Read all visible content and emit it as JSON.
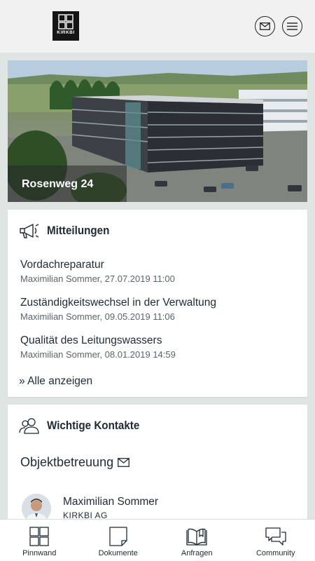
{
  "header": {
    "logo_text": "KIRKBI"
  },
  "hero": {
    "title": "Rosenweg 24"
  },
  "notices": {
    "title": "Mitteilungen",
    "items": [
      {
        "title": "Vordachreparatur",
        "meta": "Maximilian Sommer, 27.07.2019 11:00"
      },
      {
        "title": "Zuständigkeitswechsel in der Verwaltung",
        "meta": "Maximilian Sommer, 09.05.2019 11:06"
      },
      {
        "title": "Qualität des Leitungswassers",
        "meta": "Maximilian Sommer, 08.01.2019 14:59"
      }
    ],
    "show_all": "» Alle anzeigen"
  },
  "contacts": {
    "title": "Wichtige Kontakte",
    "section": "Objektbetreuung",
    "person": {
      "name": "Maximilian Sommer",
      "org": "KIRKBI AG"
    }
  },
  "nav": {
    "items": [
      {
        "label": "Pinnwand",
        "icon": "grid-icon"
      },
      {
        "label": "Dokumente",
        "icon": "document-icon"
      },
      {
        "label": "Anfragen",
        "icon": "book-icon"
      },
      {
        "label": "Community",
        "icon": "chat-icon"
      }
    ]
  },
  "colors": {
    "accent": "#2d5a3c",
    "background": "#dfe5e2"
  }
}
